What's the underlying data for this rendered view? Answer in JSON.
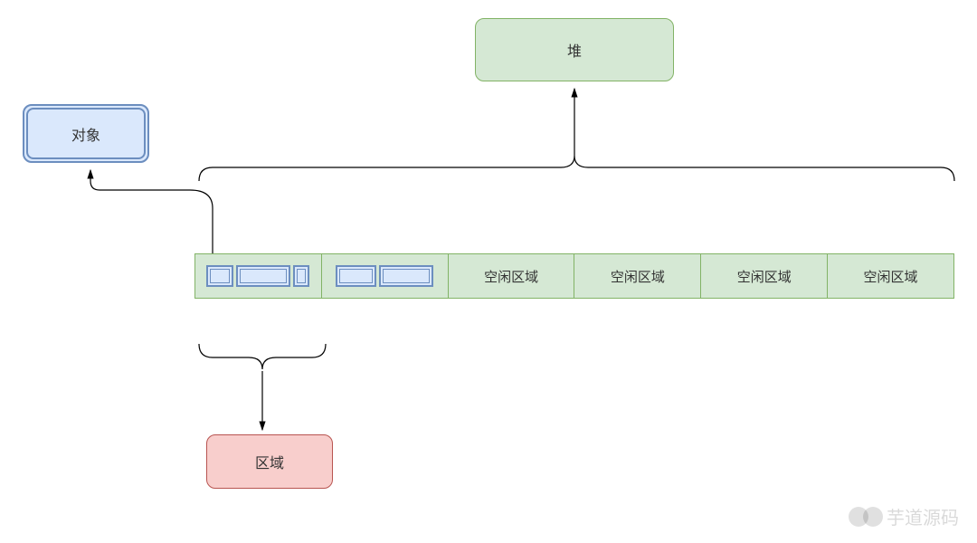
{
  "heap": {
    "label": "堆"
  },
  "object": {
    "label": "对象"
  },
  "region": {
    "label": "区域"
  },
  "memory": {
    "cells": [
      {
        "type": "used",
        "objects": [
          30,
          60,
          18
        ]
      },
      {
        "type": "used",
        "objects": [
          45,
          60
        ]
      },
      {
        "type": "free",
        "label": "空闲区域"
      },
      {
        "type": "free",
        "label": "空闲区域"
      },
      {
        "type": "free",
        "label": "空闲区域"
      },
      {
        "type": "free",
        "label": "空闲区域"
      }
    ]
  },
  "watermark": {
    "text": "芋道源码"
  }
}
